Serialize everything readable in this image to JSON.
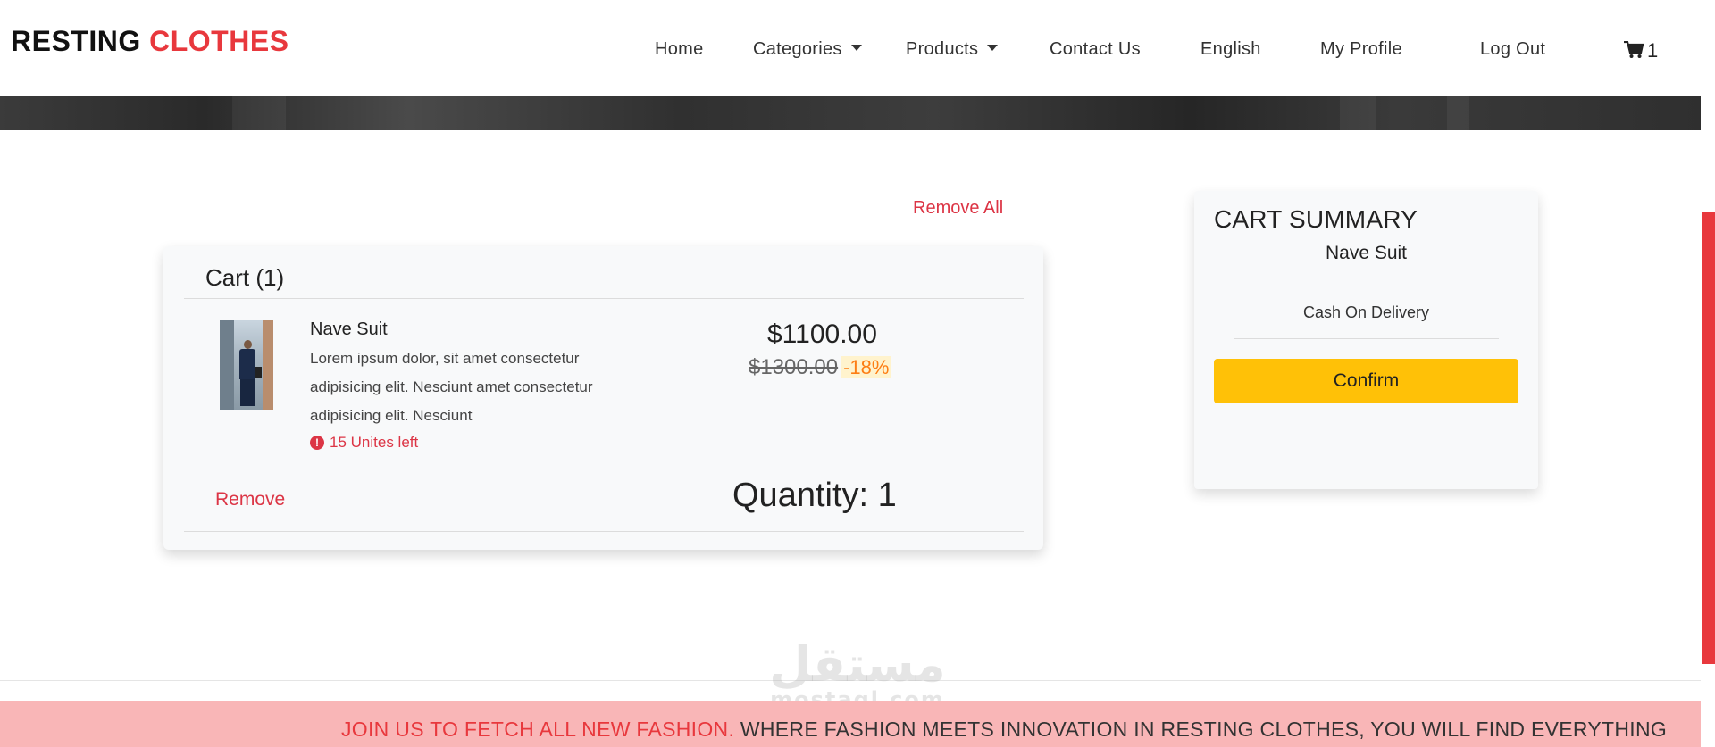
{
  "brand": {
    "part1": "RESTING",
    "part2": "CLOTHES"
  },
  "nav": {
    "home": "Home",
    "categories": "Categories",
    "products": "Products",
    "contact": "Contact Us",
    "language": "English",
    "profile": "My Profile",
    "logout": "Log Out",
    "cart_count": "1"
  },
  "cart": {
    "remove_all": "Remove All",
    "title": "Cart (1)",
    "item": {
      "name": "Nave Suit",
      "description": "Lorem ipsum dolor, sit amet consectetur adipisicing elit. Nesciunt amet consectetur adipisicing elit. Nesciunt",
      "stock": "15 Unites left",
      "price": "$1100.00",
      "old_price": "$1300.00",
      "discount": "-18%",
      "remove": "Remove",
      "quantity": "Quantity: 1"
    }
  },
  "summary": {
    "title": "CART SUMMARY",
    "item": "Nave Suit",
    "payment": "Cash On Delivery",
    "confirm": "Confirm"
  },
  "ticker": {
    "highlight": "JOIN US TO FETCH ALL NEW FASHION.",
    "text": "WHERE FASHION MEETS INNOVATION IN RESTING CLOTHES, YOU WILL FIND EVERYTHING"
  },
  "watermark": {
    "arabic": "مستقل",
    "latin": "mostaql.com"
  },
  "colors": {
    "accent": "#e8383d",
    "confirm": "#ffc107",
    "ticker_bg": "#f9b6b7",
    "discount": "#fd7e14"
  },
  "icons": {
    "cart": "shopping-cart-icon",
    "alert": "exclamation-circle-icon",
    "dropdown": "caret-down-icon"
  }
}
